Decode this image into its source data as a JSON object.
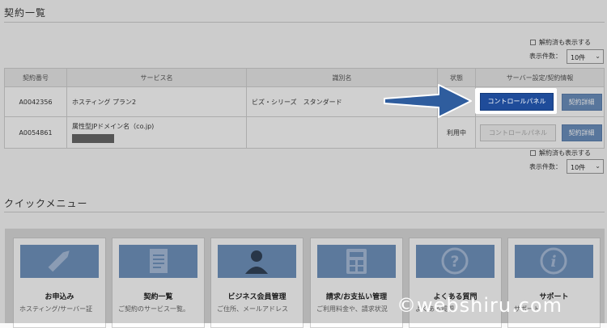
{
  "page": {
    "title": "契約一覧"
  },
  "filters_top": {
    "show_cancelled_label": "解約済も表示する",
    "per_page_label": "表示件数：",
    "per_page_value": "10件"
  },
  "table": {
    "headers": [
      "契約番号",
      "サービス名",
      "識別名",
      "状態",
      "サーバー設定/契約情報"
    ],
    "rows": [
      {
        "contract_no": "A0042356",
        "service": "ホスティング プラン2",
        "identifier": "ビズ・シリーズ　スタンダード",
        "status": "",
        "control_panel": "コントロールパネル",
        "detail": "契約詳細"
      },
      {
        "contract_no": "A0054861",
        "service": "属性型JPドメイン名（co.jp)",
        "identifier": "",
        "status": "利用中",
        "control_panel": "コントロールパネル",
        "detail": "契約詳細"
      }
    ]
  },
  "filters_bottom": {
    "show_cancelled_label": "解約済も表示する",
    "per_page_label": "表示件数：",
    "per_page_value": "10件"
  },
  "quick_menu": {
    "title": "クイックメニュー",
    "cards": [
      {
        "icon": "pencil-icon",
        "title": "お申込み",
        "desc": "ホスティング/サーバー証"
      },
      {
        "icon": "document-icon",
        "title": "契約一覧",
        "desc": "ご契約のサービス一覧。"
      },
      {
        "icon": "user-icon",
        "title": "ビジネス会員管理",
        "desc": "ご住所、メールアドレス"
      },
      {
        "icon": "calculator-icon",
        "title": "請求/お支払い管理",
        "desc": "ご利用料金や、請求状況"
      },
      {
        "icon": "question-icon",
        "title": "よくある質問",
        "desc": "よくある質問"
      },
      {
        "icon": "info-icon",
        "title": "サポート",
        "desc": "サポート"
      }
    ]
  },
  "watermark": "©webshiru.com",
  "colors": {
    "highlight_button": "#1f4c9a",
    "secondary_button": "#6a8fbf",
    "tile": "#6f93bf",
    "arrow": "#2f5d9e"
  }
}
